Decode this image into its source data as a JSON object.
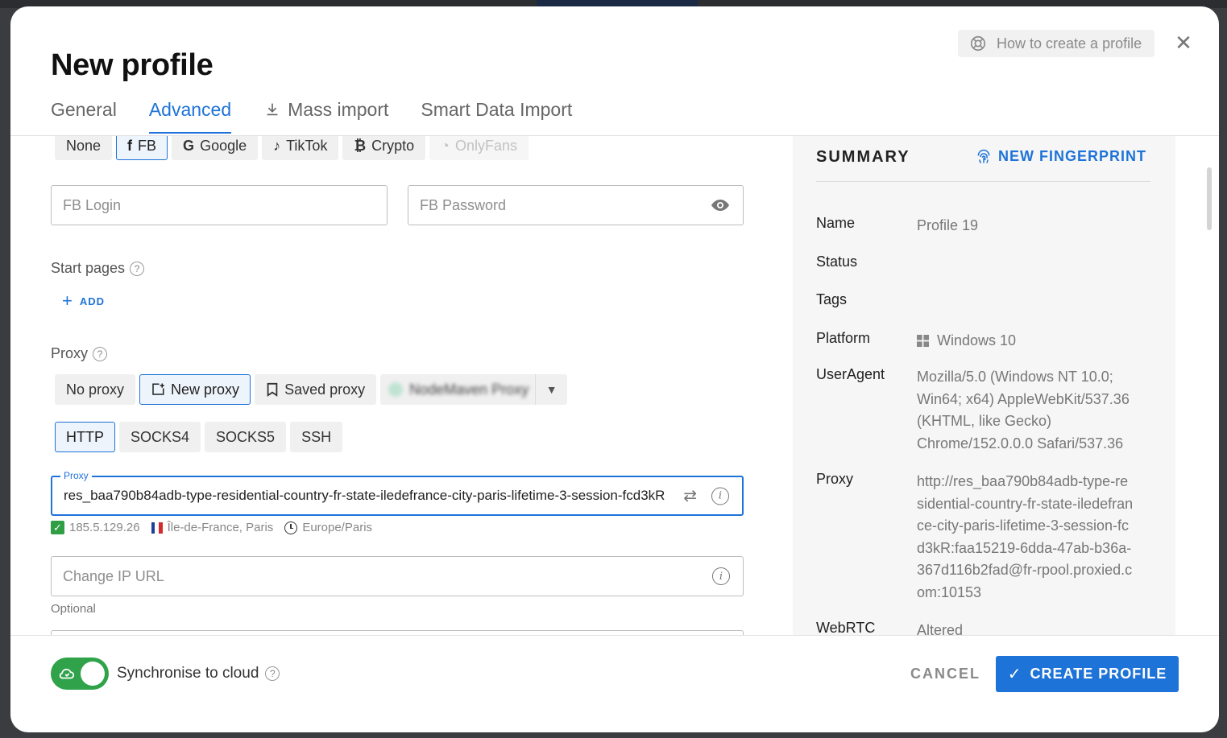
{
  "dialog": {
    "title": "New profile",
    "help_button": "How to create a profile",
    "close_icon": "close-icon"
  },
  "tabs": [
    {
      "label": "General",
      "active": false
    },
    {
      "label": "Advanced",
      "active": true
    },
    {
      "label": "Mass import",
      "icon": "download-icon",
      "active": false
    },
    {
      "label": "Smart Data Import",
      "active": false
    }
  ],
  "account_types": [
    {
      "label": "None",
      "selected": false
    },
    {
      "label": "FB",
      "icon": "facebook-icon",
      "selected": true
    },
    {
      "label": "Google",
      "icon": "google-icon",
      "selected": false
    },
    {
      "label": "TikTok",
      "icon": "tiktok-icon",
      "selected": false
    },
    {
      "label": "Crypto",
      "icon": "bitcoin-icon",
      "selected": false
    },
    {
      "label": "OnlyFans",
      "icon": "onlyfans-icon",
      "selected": false,
      "disabled": true
    }
  ],
  "fb_login": {
    "placeholder": "FB Login",
    "value": ""
  },
  "fb_password": {
    "placeholder": "FB Password",
    "value": "",
    "icon": "eye-icon"
  },
  "start_pages": {
    "label": "Start pages",
    "add_label": "ADD"
  },
  "proxy": {
    "label": "Proxy",
    "modes": [
      {
        "label": "No proxy",
        "selected": false
      },
      {
        "label": "New proxy",
        "icon": "add-box-icon",
        "selected": true
      },
      {
        "label": "Saved proxy",
        "icon": "bookmark-icon",
        "selected": false
      }
    ],
    "provider_combo": "NodeMaven Proxy",
    "protocols": [
      {
        "label": "HTTP",
        "selected": true
      },
      {
        "label": "SOCKS4",
        "selected": false
      },
      {
        "label": "SOCKS5",
        "selected": false
      },
      {
        "label": "SSH",
        "selected": false
      }
    ],
    "field_legend": "Proxy",
    "field_value": "res_baa790b84adb-type-residential-country-fr-state-iledefrance-city-paris-lifetime-3-session-fcd3kR",
    "ip": "185.5.129.26",
    "location": "Île-de-France, Paris",
    "timezone": "Europe/Paris"
  },
  "change_ip_url": {
    "placeholder": "Change IP URL",
    "helper": "Optional"
  },
  "summary": {
    "heading": "SUMMARY",
    "new_fingerprint": "NEW FINGERPRINT",
    "rows": [
      {
        "key": "Name",
        "value": "Profile 19"
      },
      {
        "key": "Status",
        "value": ""
      },
      {
        "key": "Tags",
        "value": ""
      },
      {
        "key": "Platform",
        "value": "Windows 10"
      },
      {
        "key": "UserAgent",
        "value": "Mozilla/5.0 (Windows NT 10.0; Win64; x64) AppleWebKit/537.36 (KHTML, like Gecko) Chrome/152.0.0.0 Safari/537.36"
      },
      {
        "key": "Proxy",
        "value": "http://res_baa790b84adb-type-residential-country-fr-state-iledefrance-city-paris-lifetime-3-session-fcd3kR:faa15219-6dda-47ab-b36a-367d116b2fad@fr-rpool.proxied.com:10153"
      },
      {
        "key": "WebRTC",
        "value": "Altered"
      }
    ]
  },
  "footer": {
    "sync_label": "Synchronise to cloud",
    "sync_enabled": true,
    "cancel": "CANCEL",
    "create": "CREATE PROFILE"
  },
  "colors": {
    "accent": "#1e73d8",
    "toggle_on": "#2fa24a"
  }
}
